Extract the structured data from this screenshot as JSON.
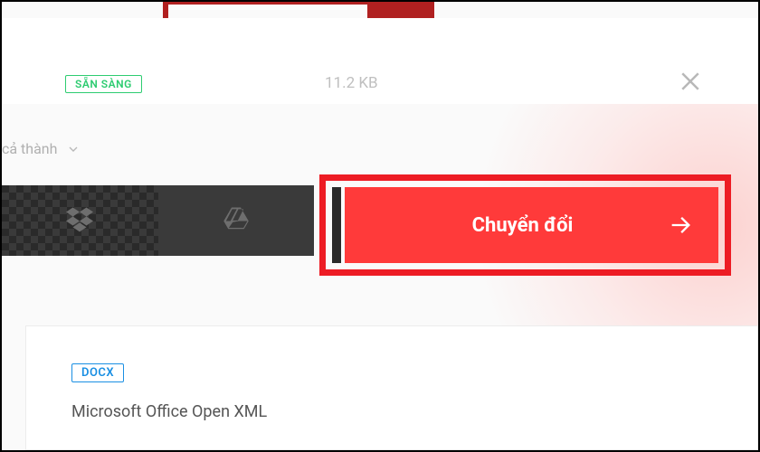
{
  "file": {
    "status_label": "SẴN SÀNG",
    "size": "11.2 KB"
  },
  "options": {
    "merge_label": "cả thành"
  },
  "actions": {
    "convert_label": "Chuyển đổi"
  },
  "format": {
    "badge": "DOCX",
    "name": "Microsoft Office Open XML"
  },
  "icons": {
    "close": "close-icon",
    "chevron_down": "chevron-down-icon",
    "dropbox": "dropbox-icon",
    "gdrive": "gdrive-icon",
    "arrow_right": "arrow-right-icon"
  }
}
